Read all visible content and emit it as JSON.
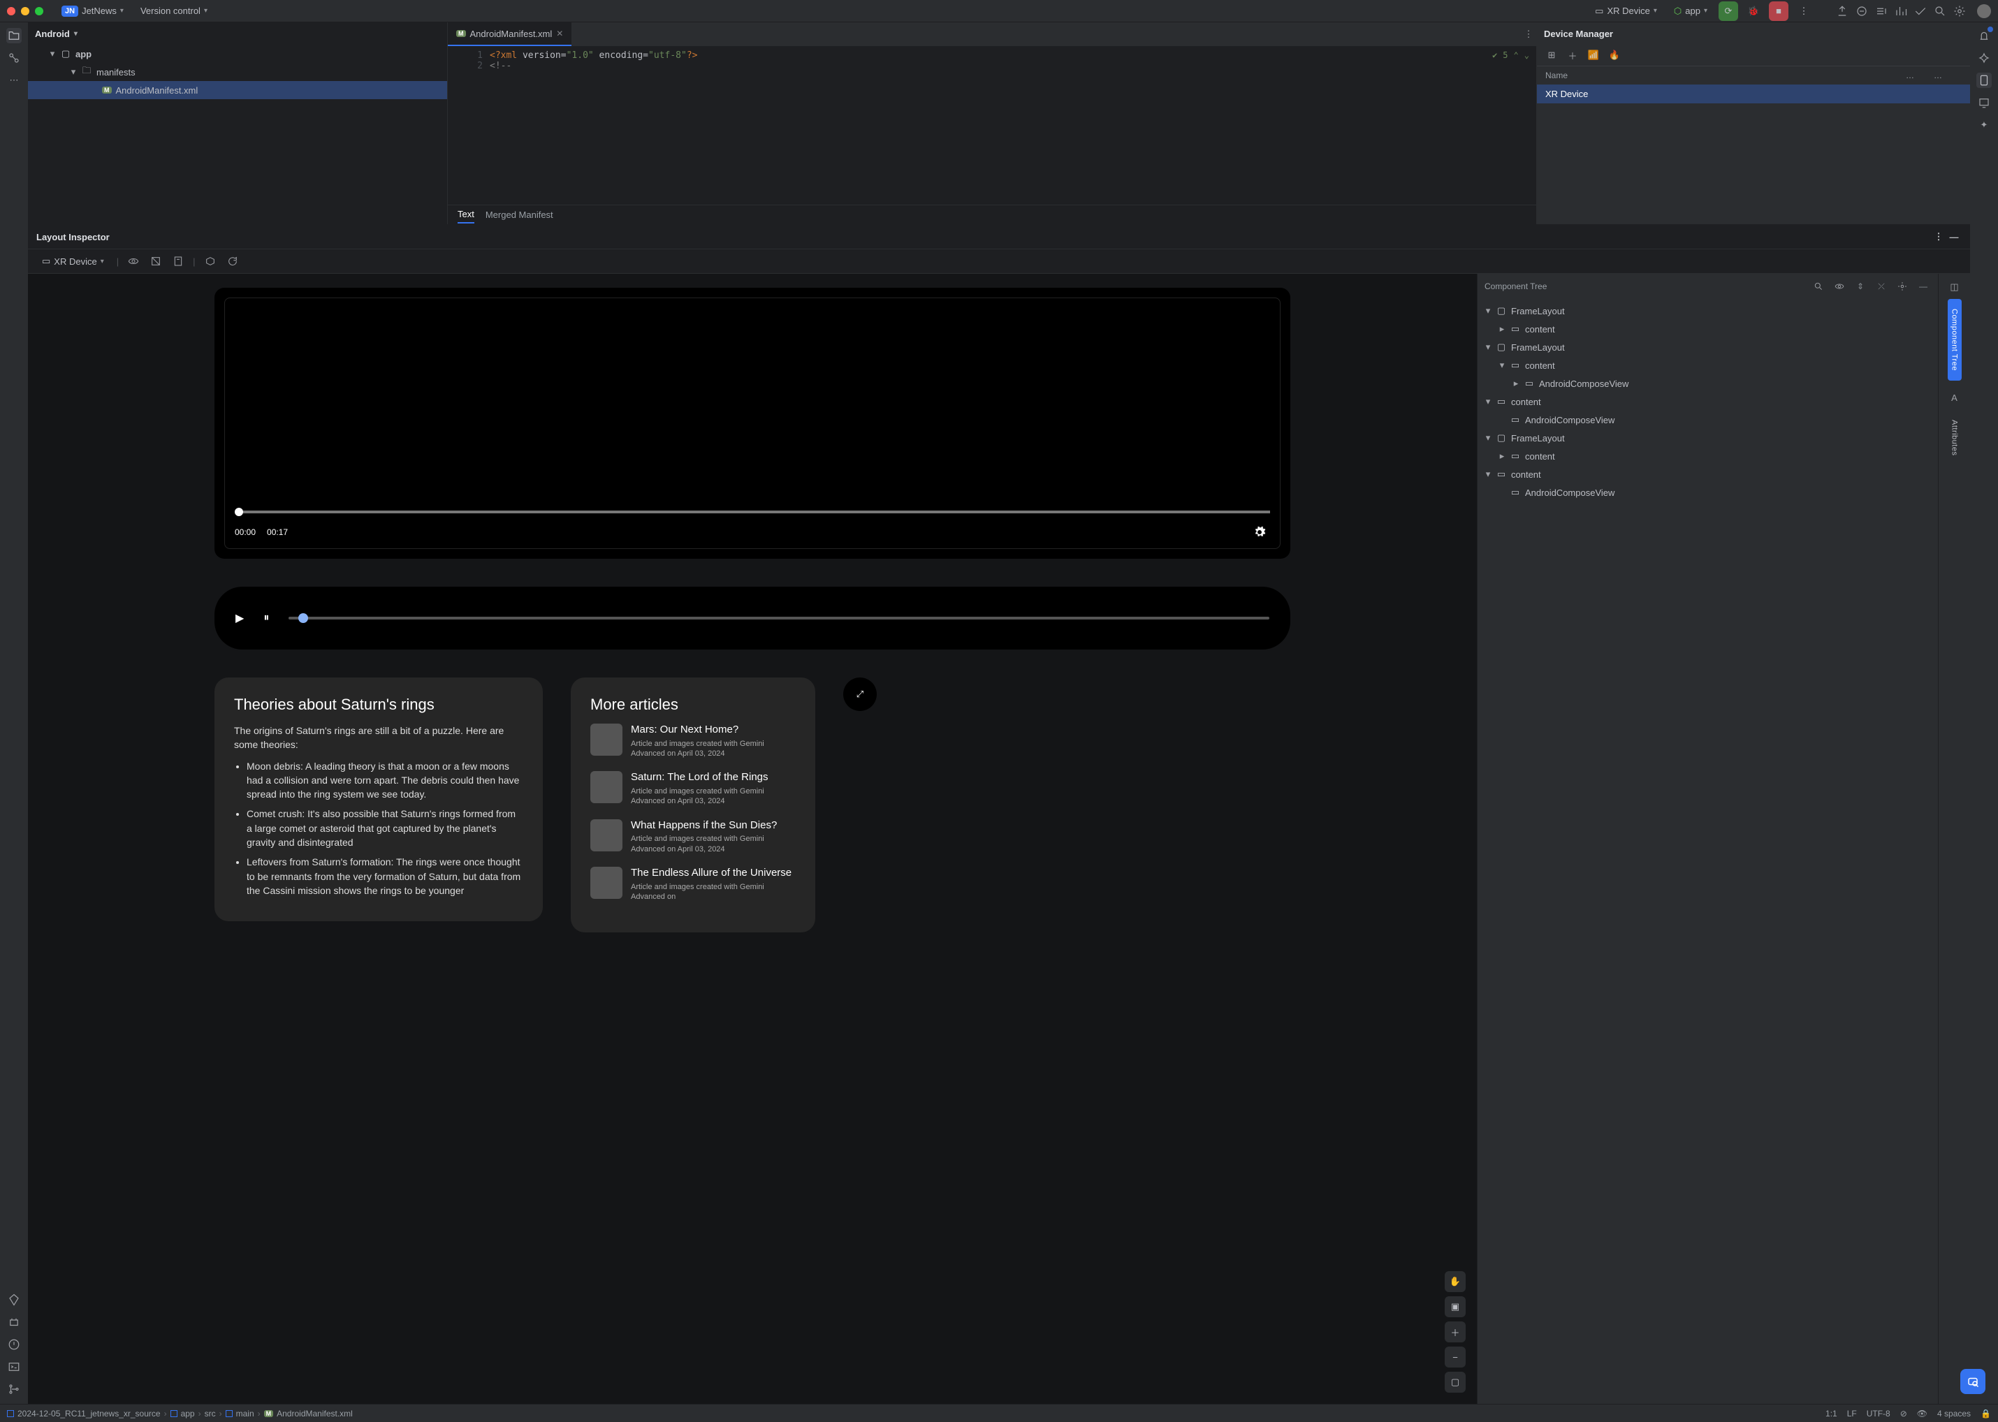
{
  "titlebar": {
    "project_initials": "JN",
    "project_name": "JetNews",
    "vcs_label": "Version control",
    "run_target": "XR Device",
    "config": "app"
  },
  "project_tree": {
    "view_mode": "Android",
    "root": "app",
    "manifests": "manifests",
    "manifest_file": "AndroidManifest.xml"
  },
  "editor": {
    "tab_label": "AndroidManifest.xml",
    "line1": "<?xml version=\"1.0\" encoding=\"utf-8\"?>",
    "line2": "<!--",
    "warnings": "5",
    "subtab_text": "Text",
    "subtab_merged": "Merged Manifest"
  },
  "device_manager": {
    "title": "Device Manager",
    "col_name": "Name",
    "device": "XR Device"
  },
  "inspector": {
    "title": "Layout Inspector",
    "device_label": "XR Device",
    "component_tree_title": "Component Tree",
    "side_tab_tree": "Component Tree",
    "side_tab_attrs": "Attributes"
  },
  "component_tree": [
    {
      "l": 0,
      "exp": "v",
      "ico": "sq",
      "label": "FrameLayout"
    },
    {
      "l": 1,
      "exp": ">",
      "ico": "tv",
      "label": "content"
    },
    {
      "l": 0,
      "exp": "v",
      "ico": "sq",
      "label": "FrameLayout"
    },
    {
      "l": 1,
      "exp": "v",
      "ico": "tv",
      "label": "content"
    },
    {
      "l": 2,
      "exp": ">",
      "ico": "tv",
      "label": "AndroidComposeView"
    },
    {
      "l": 0,
      "exp": "v",
      "ico": "tv",
      "label": "content"
    },
    {
      "l": 1,
      "exp": "",
      "ico": "tv",
      "label": "AndroidComposeView"
    },
    {
      "l": 0,
      "exp": "v",
      "ico": "sq",
      "label": "FrameLayout"
    },
    {
      "l": 1,
      "exp": ">",
      "ico": "tv",
      "label": "content"
    },
    {
      "l": 0,
      "exp": "v",
      "ico": "tv",
      "label": "content"
    },
    {
      "l": 1,
      "exp": "",
      "ico": "tv",
      "label": "AndroidComposeView"
    }
  ],
  "canvas": {
    "video_time_cur": "00:00",
    "video_time_dur": "00:17",
    "theory_title": "Theories about Saturn's rings",
    "theory_intro": "The origins of Saturn's rings are still a bit of a puzzle. Here are some theories:",
    "theory_b1": "Moon debris: A leading theory is that a moon or a few moons had a collision and were torn apart. The debris could then have spread into the ring system we see today.",
    "theory_b2": "Comet crush: It's also possible that Saturn's rings formed from a large comet or asteroid that got captured by the planet's gravity and disintegrated",
    "theory_b3": "Leftovers from Saturn's formation: The rings were once thought to be remnants from the very formation of Saturn, but data from the Cassini mission shows the rings to be younger",
    "more_title": "More articles",
    "articles": [
      {
        "title": "Mars: Our Next Home?",
        "sub": "Article and images created with Gemini Advanced on April 03, 2024"
      },
      {
        "title": "Saturn: The Lord of the Rings",
        "sub": "Article and images created with Gemini Advanced on April 03, 2024"
      },
      {
        "title": "What Happens if the Sun Dies?",
        "sub": "Article and images created with Gemini Advanced on April 03, 2024"
      },
      {
        "title": "The Endless Allure of the Universe",
        "sub": "Article and images created with Gemini Advanced on"
      }
    ]
  },
  "breadcrumbs": {
    "b0": "2024-12-05_RC11_jetnews_xr_source",
    "b1": "app",
    "b2": "src",
    "b3": "main",
    "b4": "AndroidManifest.xml"
  },
  "status": {
    "pos": "1:1",
    "eol": "LF",
    "enc": "UTF-8",
    "indent": "4 spaces"
  }
}
